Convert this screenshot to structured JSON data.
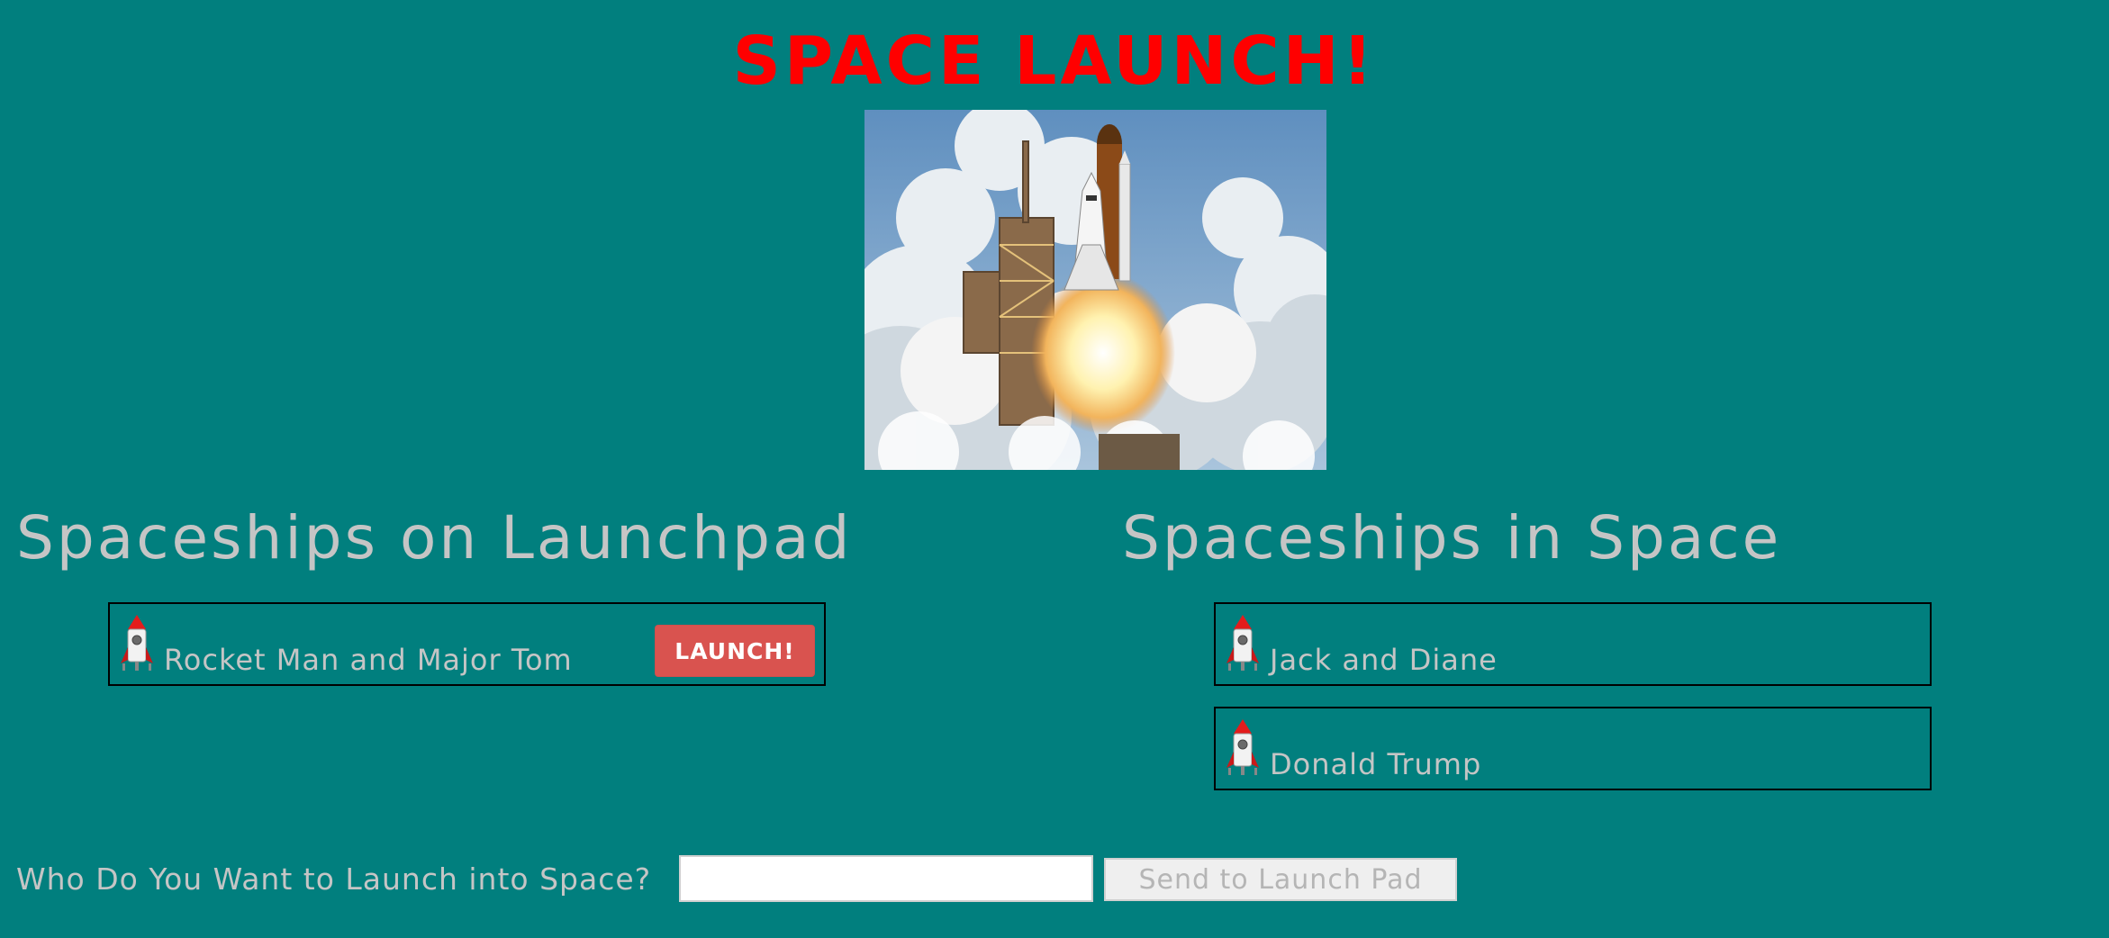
{
  "page": {
    "title": "SPACE LAUNCH!",
    "hero_image_icon": "space-shuttle-launch-photo"
  },
  "launchpad": {
    "heading": "Spaceships on Launchpad",
    "ships": [
      {
        "name": "Rocket Man and Major Tom",
        "icon": "rocket-icon",
        "button_label": "LAUNCH!"
      }
    ]
  },
  "space": {
    "heading": "Spaceships in Space",
    "ships": [
      {
        "name": "Jack and Diane",
        "icon": "rocket-icon"
      },
      {
        "name": "Donald Trump",
        "icon": "rocket-icon"
      }
    ]
  },
  "form": {
    "label": "Who Do You Want to Launch into Space?",
    "input_value": "",
    "button_label": "Send to Launch Pad"
  },
  "colors": {
    "background": "#017f7e",
    "title": "#ff0000",
    "text": "#c5c5c5",
    "launch_button": "#d9534f"
  }
}
